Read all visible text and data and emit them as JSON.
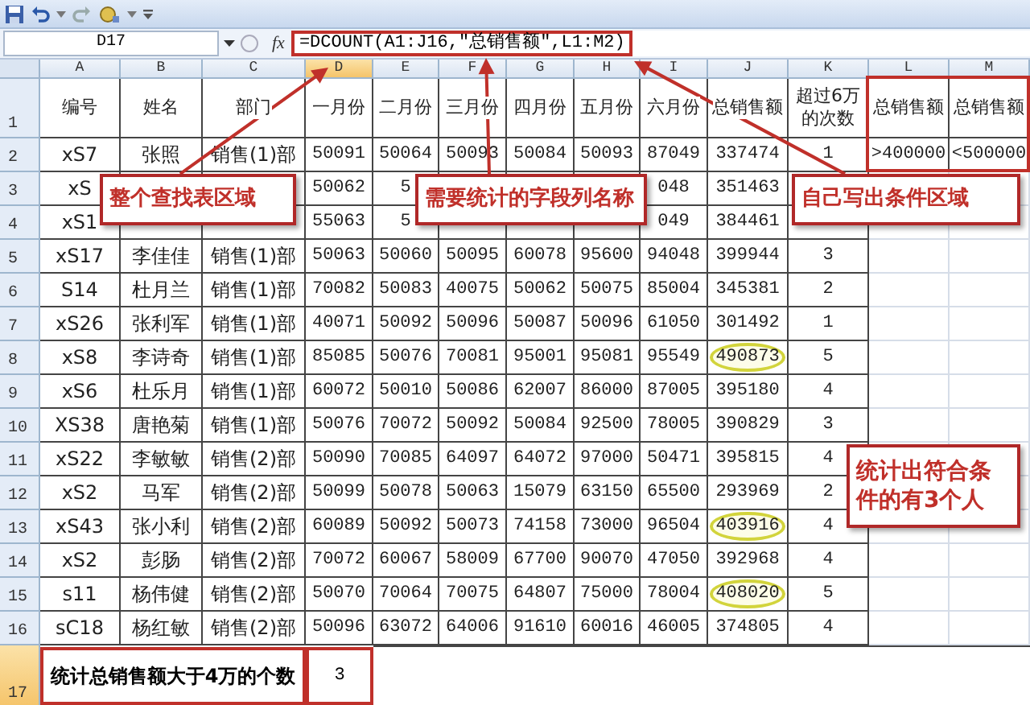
{
  "name_box": "D17",
  "function_label": "fx",
  "formula": "=DCOUNT(A1:J16,\"总销售额\",L1:M2)",
  "columns": [
    {
      "label": "A",
      "selected": false
    },
    {
      "label": "B",
      "selected": false
    },
    {
      "label": "C",
      "selected": false
    },
    {
      "label": "D",
      "selected": true
    },
    {
      "label": "E",
      "selected": false
    },
    {
      "label": "F",
      "selected": false
    },
    {
      "label": "G",
      "selected": false
    },
    {
      "label": "H",
      "selected": false
    },
    {
      "label": "I",
      "selected": false
    },
    {
      "label": "J",
      "selected": false
    },
    {
      "label": "K",
      "selected": false
    },
    {
      "label": "L",
      "selected": false
    },
    {
      "label": "M",
      "selected": false
    }
  ],
  "header_row": {
    "number": "1",
    "selected": false,
    "cells": [
      "编号",
      "姓名",
      "部门",
      "一月份",
      "二月份",
      "三月份",
      "四月份",
      "五月份",
      "六月份",
      "总销售额",
      "超过6万的次数",
      "总销售额",
      "总销售额"
    ]
  },
  "rows": [
    {
      "number": "2",
      "selected": false,
      "circled": false,
      "cells": [
        "xS7",
        "张照",
        "销售(1)部",
        "50091",
        "50064",
        "50093",
        "50084",
        "50093",
        "87049",
        "337474",
        "1",
        ">400000",
        "<500000"
      ]
    },
    {
      "number": "3",
      "selected": false,
      "circled": false,
      "cells": [
        "xS",
        null,
        null,
        "50062",
        "5",
        null,
        null,
        null,
        "048",
        "351463",
        null
      ]
    },
    {
      "number": "4",
      "selected": false,
      "circled": false,
      "cells": [
        "xS1",
        null,
        null,
        "55063",
        "5",
        null,
        null,
        null,
        "049",
        "384461",
        null
      ]
    },
    {
      "number": "5",
      "selected": false,
      "circled": false,
      "cells": [
        "xS17",
        "李佳佳",
        "销售(1)部",
        "50063",
        "50060",
        "50095",
        "60078",
        "95600",
        "94048",
        "399944",
        "3"
      ]
    },
    {
      "number": "6",
      "selected": false,
      "circled": false,
      "cells": [
        "S14",
        "杜月兰",
        "销售(1)部",
        "70082",
        "50083",
        "40075",
        "50062",
        "50075",
        "85004",
        "345381",
        "2"
      ]
    },
    {
      "number": "7",
      "selected": false,
      "circled": false,
      "cells": [
        "xS26",
        "张利军",
        "销售(1)部",
        "40071",
        "50092",
        "50096",
        "50087",
        "50096",
        "61050",
        "301492",
        "1"
      ]
    },
    {
      "number": "8",
      "selected": false,
      "circled": true,
      "cells": [
        "xS8",
        "李诗奇",
        "销售(1)部",
        "85085",
        "50076",
        "70081",
        "95001",
        "95081",
        "95549",
        "490873",
        "5"
      ]
    },
    {
      "number": "9",
      "selected": false,
      "circled": false,
      "cells": [
        "xS6",
        "杜乐月",
        "销售(1)部",
        "60072",
        "50010",
        "50086",
        "62007",
        "86000",
        "87005",
        "395180",
        "4"
      ]
    },
    {
      "number": "10",
      "selected": false,
      "circled": false,
      "cells": [
        "XS38",
        "唐艳菊",
        "销售(1)部",
        "50076",
        "70072",
        "50092",
        "50084",
        "92500",
        "78005",
        "390829",
        "3"
      ]
    },
    {
      "number": "11",
      "selected": false,
      "circled": false,
      "cells": [
        "xS22",
        "李敏敏",
        "销售(2)部",
        "50090",
        "70085",
        "64097",
        "64072",
        "97000",
        "50471",
        "395815",
        "4"
      ]
    },
    {
      "number": "12",
      "selected": false,
      "circled": false,
      "cells": [
        "xS2",
        "马军",
        "销售(2)部",
        "50099",
        "50078",
        "50063",
        "15079",
        "63150",
        "65500",
        "293969",
        "2"
      ]
    },
    {
      "number": "13",
      "selected": false,
      "circled": true,
      "cells": [
        "xS43",
        "张小利",
        "销售(2)部",
        "60089",
        "50092",
        "50073",
        "74158",
        "73000",
        "96504",
        "403916",
        "4"
      ]
    },
    {
      "number": "14",
      "selected": false,
      "circled": false,
      "cells": [
        "xS2",
        "彭肠",
        "销售(2)部",
        "70072",
        "60067",
        "58009",
        "67700",
        "90070",
        "47050",
        "392968",
        "4"
      ]
    },
    {
      "number": "15",
      "selected": false,
      "circled": true,
      "cells": [
        "s11",
        "杨伟健",
        "销售(2)部",
        "50070",
        "70064",
        "70075",
        "64807",
        "75000",
        "78004",
        "408020",
        "5"
      ]
    },
    {
      "number": "16",
      "selected": false,
      "circled": false,
      "cells": [
        "sC18",
        "杨红敏",
        "销售(2)部",
        "50096",
        "63072",
        "64006",
        "91610",
        "60016",
        "46005",
        "374805",
        "4"
      ]
    }
  ],
  "summary_row": {
    "number": "17",
    "selected": true,
    "label": "统计总销售额大于4万的个数",
    "value": "3"
  },
  "callouts": [
    "整个查找表区域",
    "需要统计的字段列名称",
    "自己写出条件区域",
    "统计出符合条件的有3个人"
  ]
}
